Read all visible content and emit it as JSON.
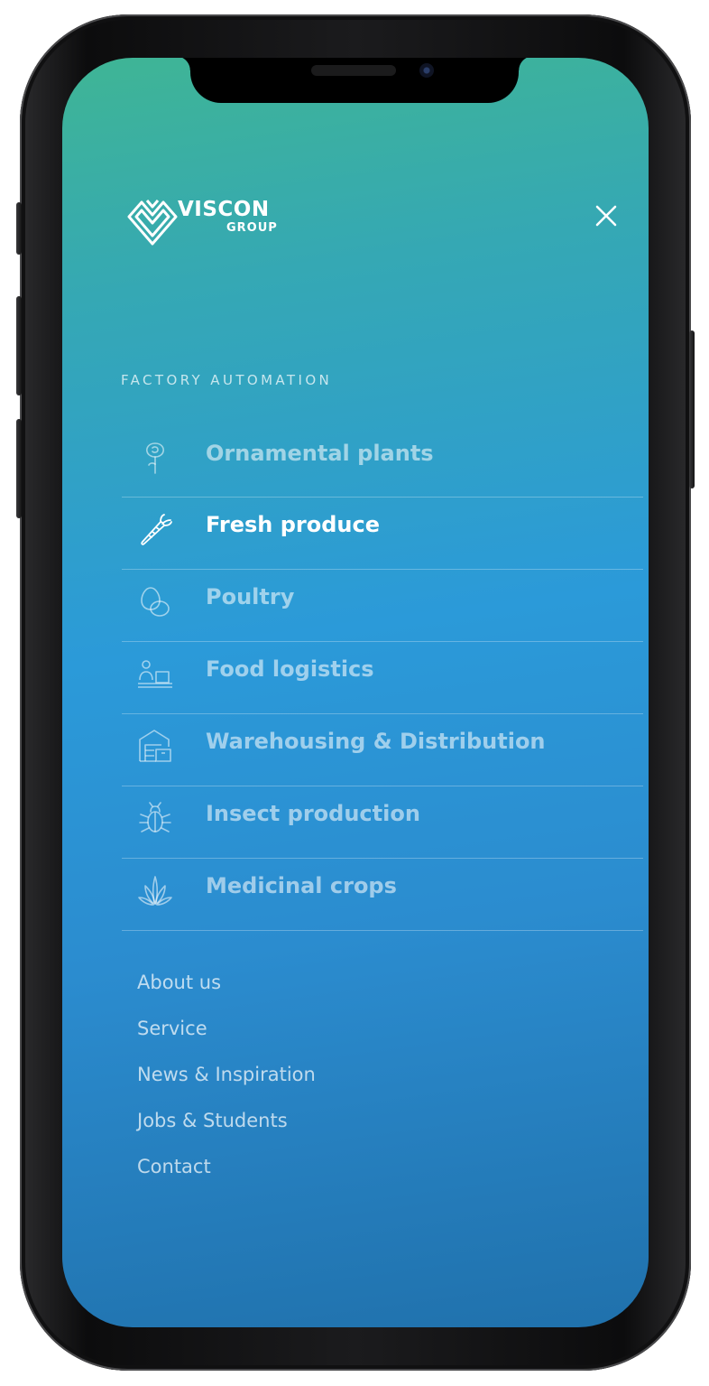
{
  "brand": {
    "name": "VISCON",
    "subname": "GROUP"
  },
  "icons": {
    "close": "close-icon"
  },
  "section": {
    "heading": "FACTORY AUTOMATION"
  },
  "menu": {
    "items": [
      {
        "label": "Ornamental plants",
        "icon": "rose-icon",
        "active": false
      },
      {
        "label": "Fresh produce",
        "icon": "carrot-icon",
        "active": true
      },
      {
        "label": "Poultry",
        "icon": "eggs-icon",
        "active": false
      },
      {
        "label": "Food logistics",
        "icon": "person-crate-icon",
        "active": false
      },
      {
        "label": "Warehousing & Distribution",
        "icon": "warehouse-icon",
        "active": false
      },
      {
        "label": "Insect production",
        "icon": "bug-icon",
        "active": false
      },
      {
        "label": "Medicinal crops",
        "icon": "leaf-icon",
        "active": false
      }
    ]
  },
  "secondary_links": [
    {
      "label": "About us"
    },
    {
      "label": "Service"
    },
    {
      "label": "News & Inspiration"
    },
    {
      "label": "Jobs & Students"
    },
    {
      "label": "Contact"
    }
  ],
  "colors": {
    "gradient_top": "#3fb595",
    "gradient_mid": "#2b9ad9",
    "gradient_bottom": "#2071ac",
    "active_text": "#ffffff"
  }
}
